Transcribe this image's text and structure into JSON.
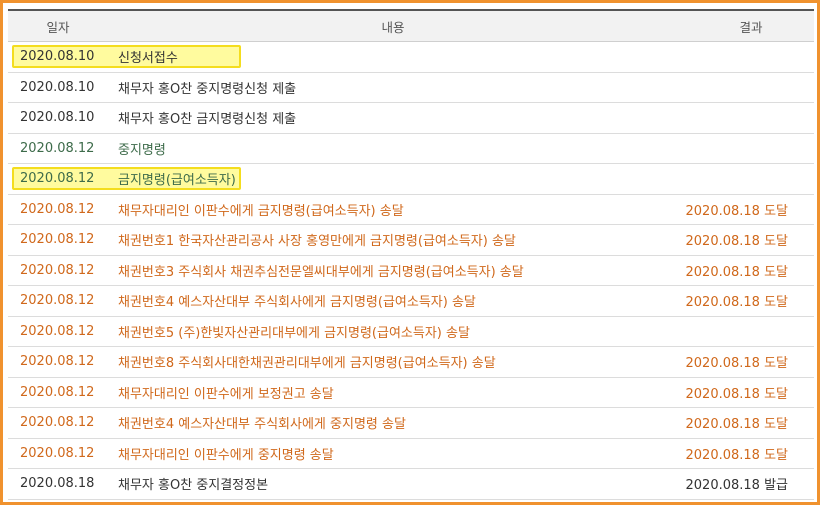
{
  "header": {
    "date": "일자",
    "content": "내용",
    "result": "결과"
  },
  "rows": [
    {
      "date": "2020.08.10",
      "content": "신청서접수",
      "result": "",
      "color": "dark",
      "highlight": true
    },
    {
      "date": "2020.08.10",
      "content": "채무자 홍O찬 중지명령신청 제출",
      "result": "",
      "color": "dark"
    },
    {
      "date": "2020.08.10",
      "content": "채무자 홍O찬 금지명령신청 제출",
      "result": "",
      "color": "dark"
    },
    {
      "date": "2020.08.12",
      "content": "중지명령",
      "result": "",
      "color": "green"
    },
    {
      "date": "2020.08.12",
      "content": "금지명령(급여소득자)",
      "result": "",
      "color": "green",
      "highlight": true
    },
    {
      "date": "2020.08.12",
      "content": "채무자대리인 이판수에게 금지명령(급여소득자) 송달",
      "result": "2020.08.18 도달",
      "color": "orange"
    },
    {
      "date": "2020.08.12",
      "content": "채권번호1 한국자산관리공사 사장 홍영만에게 금지명령(급여소득자) 송달",
      "result": "2020.08.18 도달",
      "color": "orange"
    },
    {
      "date": "2020.08.12",
      "content": "채권번호3 주식회사 채권추심전문엘씨대부에게 금지명령(급여소득자) 송달",
      "result": "2020.08.18 도달",
      "color": "orange"
    },
    {
      "date": "2020.08.12",
      "content": "채권번호4 예스자산대부 주식회사에게 금지명령(급여소득자) 송달",
      "result": "2020.08.18 도달",
      "color": "orange"
    },
    {
      "date": "2020.08.12",
      "content": "채권번호5 (주)한빛자산관리대부에게 금지명령(급여소득자) 송달",
      "result": "",
      "color": "orange"
    },
    {
      "date": "2020.08.12",
      "content": "채권번호8 주식회사대한채권관리대부에게 금지명령(급여소득자) 송달",
      "result": "2020.08.18 도달",
      "color": "orange"
    },
    {
      "date": "2020.08.12",
      "content": "채무자대리인 이판수에게 보정권고 송달",
      "result": "2020.08.18 도달",
      "color": "orange"
    },
    {
      "date": "2020.08.12",
      "content": "채권번호4 예스자산대부 주식회사에게 중지명령 송달",
      "result": "2020.08.18 도달",
      "color": "orange"
    },
    {
      "date": "2020.08.12",
      "content": "채무자대리인 이판수에게 중지명령 송달",
      "result": "2020.08.18 도달",
      "color": "orange"
    },
    {
      "date": "2020.08.18",
      "content": "채무자 홍O찬 중지결정정본",
      "result": "2020.08.18 발급",
      "color": "dark"
    }
  ],
  "colors": {
    "border": "#f0922e",
    "highlight_fill": "#fffb9e",
    "highlight_border": "#f4dd1e",
    "orange_text": "#d0681b",
    "green_text": "#3d6b4a"
  }
}
